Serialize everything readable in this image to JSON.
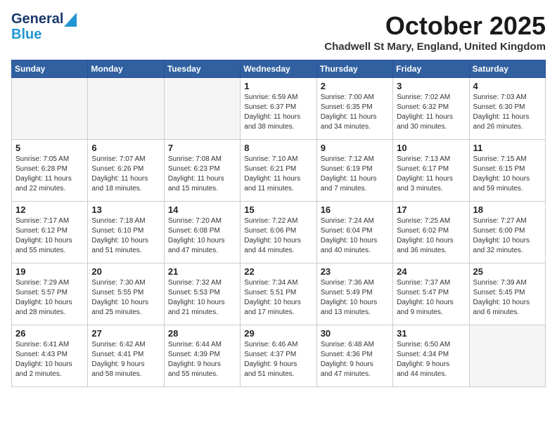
{
  "header": {
    "logo_general": "General",
    "logo_blue": "Blue",
    "month_title": "October 2025",
    "location": "Chadwell St Mary, England, United Kingdom"
  },
  "days_of_week": [
    "Sunday",
    "Monday",
    "Tuesday",
    "Wednesday",
    "Thursday",
    "Friday",
    "Saturday"
  ],
  "weeks": [
    [
      {
        "day": "",
        "info": ""
      },
      {
        "day": "",
        "info": ""
      },
      {
        "day": "",
        "info": ""
      },
      {
        "day": "1",
        "info": "Sunrise: 6:59 AM\nSunset: 6:37 PM\nDaylight: 11 hours\nand 38 minutes."
      },
      {
        "day": "2",
        "info": "Sunrise: 7:00 AM\nSunset: 6:35 PM\nDaylight: 11 hours\nand 34 minutes."
      },
      {
        "day": "3",
        "info": "Sunrise: 7:02 AM\nSunset: 6:32 PM\nDaylight: 11 hours\nand 30 minutes."
      },
      {
        "day": "4",
        "info": "Sunrise: 7:03 AM\nSunset: 6:30 PM\nDaylight: 11 hours\nand 26 minutes."
      }
    ],
    [
      {
        "day": "5",
        "info": "Sunrise: 7:05 AM\nSunset: 6:28 PM\nDaylight: 11 hours\nand 22 minutes."
      },
      {
        "day": "6",
        "info": "Sunrise: 7:07 AM\nSunset: 6:26 PM\nDaylight: 11 hours\nand 18 minutes."
      },
      {
        "day": "7",
        "info": "Sunrise: 7:08 AM\nSunset: 6:23 PM\nDaylight: 11 hours\nand 15 minutes."
      },
      {
        "day": "8",
        "info": "Sunrise: 7:10 AM\nSunset: 6:21 PM\nDaylight: 11 hours\nand 11 minutes."
      },
      {
        "day": "9",
        "info": "Sunrise: 7:12 AM\nSunset: 6:19 PM\nDaylight: 11 hours\nand 7 minutes."
      },
      {
        "day": "10",
        "info": "Sunrise: 7:13 AM\nSunset: 6:17 PM\nDaylight: 11 hours\nand 3 minutes."
      },
      {
        "day": "11",
        "info": "Sunrise: 7:15 AM\nSunset: 6:15 PM\nDaylight: 10 hours\nand 59 minutes."
      }
    ],
    [
      {
        "day": "12",
        "info": "Sunrise: 7:17 AM\nSunset: 6:12 PM\nDaylight: 10 hours\nand 55 minutes."
      },
      {
        "day": "13",
        "info": "Sunrise: 7:18 AM\nSunset: 6:10 PM\nDaylight: 10 hours\nand 51 minutes."
      },
      {
        "day": "14",
        "info": "Sunrise: 7:20 AM\nSunset: 6:08 PM\nDaylight: 10 hours\nand 47 minutes."
      },
      {
        "day": "15",
        "info": "Sunrise: 7:22 AM\nSunset: 6:06 PM\nDaylight: 10 hours\nand 44 minutes."
      },
      {
        "day": "16",
        "info": "Sunrise: 7:24 AM\nSunset: 6:04 PM\nDaylight: 10 hours\nand 40 minutes."
      },
      {
        "day": "17",
        "info": "Sunrise: 7:25 AM\nSunset: 6:02 PM\nDaylight: 10 hours\nand 36 minutes."
      },
      {
        "day": "18",
        "info": "Sunrise: 7:27 AM\nSunset: 6:00 PM\nDaylight: 10 hours\nand 32 minutes."
      }
    ],
    [
      {
        "day": "19",
        "info": "Sunrise: 7:29 AM\nSunset: 5:57 PM\nDaylight: 10 hours\nand 28 minutes."
      },
      {
        "day": "20",
        "info": "Sunrise: 7:30 AM\nSunset: 5:55 PM\nDaylight: 10 hours\nand 25 minutes."
      },
      {
        "day": "21",
        "info": "Sunrise: 7:32 AM\nSunset: 5:53 PM\nDaylight: 10 hours\nand 21 minutes."
      },
      {
        "day": "22",
        "info": "Sunrise: 7:34 AM\nSunset: 5:51 PM\nDaylight: 10 hours\nand 17 minutes."
      },
      {
        "day": "23",
        "info": "Sunrise: 7:36 AM\nSunset: 5:49 PM\nDaylight: 10 hours\nand 13 minutes."
      },
      {
        "day": "24",
        "info": "Sunrise: 7:37 AM\nSunset: 5:47 PM\nDaylight: 10 hours\nand 9 minutes."
      },
      {
        "day": "25",
        "info": "Sunrise: 7:39 AM\nSunset: 5:45 PM\nDaylight: 10 hours\nand 6 minutes."
      }
    ],
    [
      {
        "day": "26",
        "info": "Sunrise: 6:41 AM\nSunset: 4:43 PM\nDaylight: 10 hours\nand 2 minutes."
      },
      {
        "day": "27",
        "info": "Sunrise: 6:42 AM\nSunset: 4:41 PM\nDaylight: 9 hours\nand 58 minutes."
      },
      {
        "day": "28",
        "info": "Sunrise: 6:44 AM\nSunset: 4:39 PM\nDaylight: 9 hours\nand 55 minutes."
      },
      {
        "day": "29",
        "info": "Sunrise: 6:46 AM\nSunset: 4:37 PM\nDaylight: 9 hours\nand 51 minutes."
      },
      {
        "day": "30",
        "info": "Sunrise: 6:48 AM\nSunset: 4:36 PM\nDaylight: 9 hours\nand 47 minutes."
      },
      {
        "day": "31",
        "info": "Sunrise: 6:50 AM\nSunset: 4:34 PM\nDaylight: 9 hours\nand 44 minutes."
      },
      {
        "day": "",
        "info": ""
      }
    ]
  ]
}
